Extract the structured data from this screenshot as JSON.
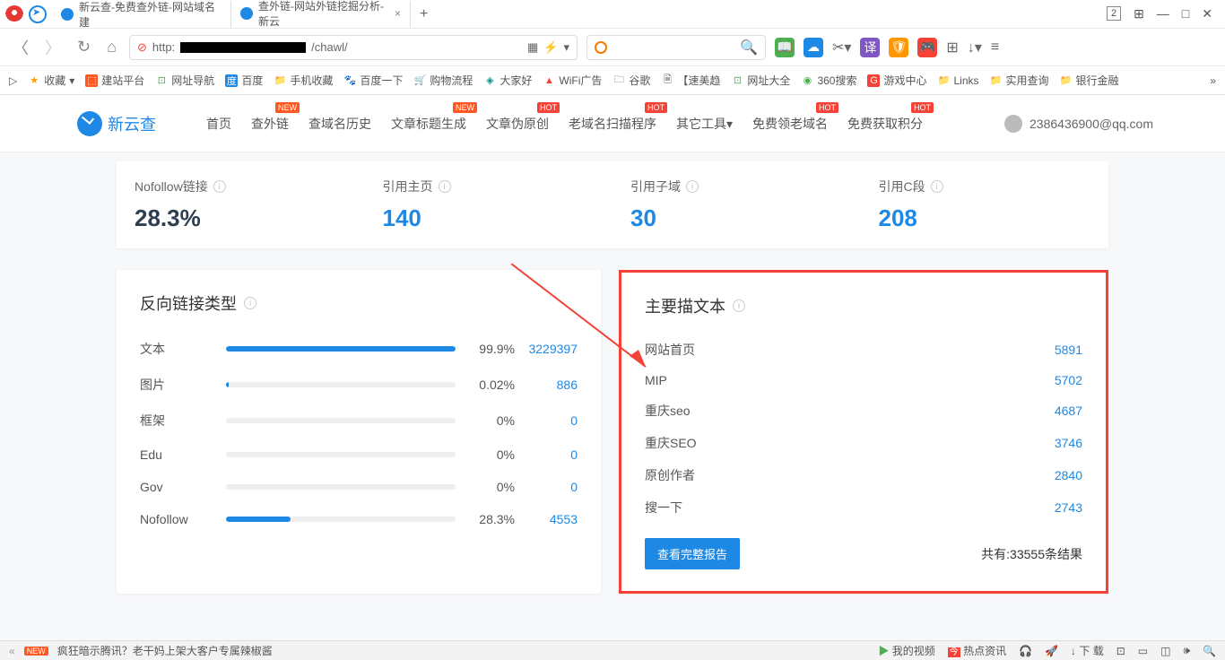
{
  "tabs": [
    {
      "title": "新云查-免费查外链-网站域名建"
    },
    {
      "title": "查外链-网站外链挖掘分析-新云"
    }
  ],
  "window_num": "2",
  "url_prefix": "http:",
  "url_suffix": "/chawl/",
  "bookmarks": {
    "star": "收藏",
    "items": [
      "建站平台",
      "网址导航",
      "百度",
      "手机收藏",
      "百度一下",
      "购物流程",
      "大家好",
      "WiFi广告",
      "谷歌",
      "【速美趋",
      "网址大全",
      "360搜索",
      "游戏中心",
      "Links",
      "实用查询",
      "银行金融"
    ]
  },
  "logo": "新云查",
  "nav": [
    {
      "t": "首页"
    },
    {
      "t": "查外链",
      "b": "NEW"
    },
    {
      "t": "查域名历史"
    },
    {
      "t": "文章标题生成",
      "b": "NEW"
    },
    {
      "t": "文章伪原创",
      "b": "HOT"
    },
    {
      "t": "老域名扫描程序",
      "b": "HOT"
    },
    {
      "t": "其它工具▾"
    },
    {
      "t": "免费领老域名",
      "b": "HOT"
    },
    {
      "t": "免费获取积分",
      "b": "HOT"
    }
  ],
  "user": "2386436900@qq.com",
  "stats": [
    {
      "l": "Nofollow链接",
      "v": "28.3%",
      "dark": true
    },
    {
      "l": "引用主页",
      "v": "140"
    },
    {
      "l": "引用子域",
      "v": "30"
    },
    {
      "l": "引用C段",
      "v": "208"
    }
  ],
  "backlink_types": {
    "title": "反向链接类型",
    "rows": [
      {
        "n": "文本",
        "p": "99.9%",
        "c": "3229397",
        "w": 100
      },
      {
        "n": "图片",
        "p": "0.02%",
        "c": "886",
        "w": 1
      },
      {
        "n": "框架",
        "p": "0%",
        "c": "0",
        "w": 0
      },
      {
        "n": "Edu",
        "p": "0%",
        "c": "0",
        "w": 0
      },
      {
        "n": "Gov",
        "p": "0%",
        "c": "0",
        "w": 0
      },
      {
        "n": "Nofollow",
        "p": "28.3%",
        "c": "4553",
        "w": 28
      }
    ]
  },
  "anchors": {
    "title": "主要描文本",
    "rows": [
      {
        "n": "网站首页",
        "c": "5891"
      },
      {
        "n": "MIP",
        "c": "5702"
      },
      {
        "n": "重庆seo",
        "c": "4687"
      },
      {
        "n": "重庆SEO",
        "c": "3746"
      },
      {
        "n": "原创作者",
        "c": "2840"
      },
      {
        "n": "搜一下",
        "c": "2743"
      }
    ],
    "btn": "查看完整报告",
    "total": "共有:33555条结果"
  },
  "bottom": {
    "news": "疯狂暗示腾讯？老干妈上架大客户专属辣椒酱",
    "video": "我的视频",
    "hot": "热点资讯",
    "dl": "下 载"
  }
}
